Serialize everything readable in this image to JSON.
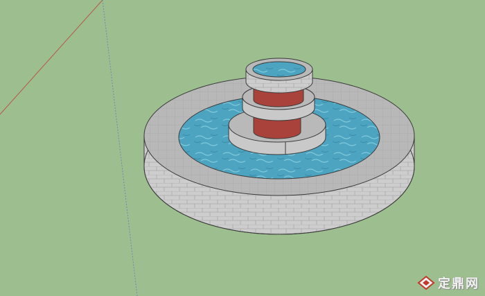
{
  "canvas": {
    "background_color": "#9dbe8f"
  },
  "model": {
    "subject": "fountain",
    "colors": {
      "stone_top": "#b9b9b9",
      "stone_side": "#cfcfcf",
      "water": "#4ea6c0",
      "column_red": "#a9423a",
      "edge_line": "#3a3a3a"
    }
  },
  "axes": {
    "red_axis_color": "#b5584a",
    "blue_axis_color": "#6f8bb0"
  },
  "watermark": {
    "text": "定鼎网",
    "logo_icon": "diamond-logo-icon",
    "logo_color": "#c0392b"
  }
}
